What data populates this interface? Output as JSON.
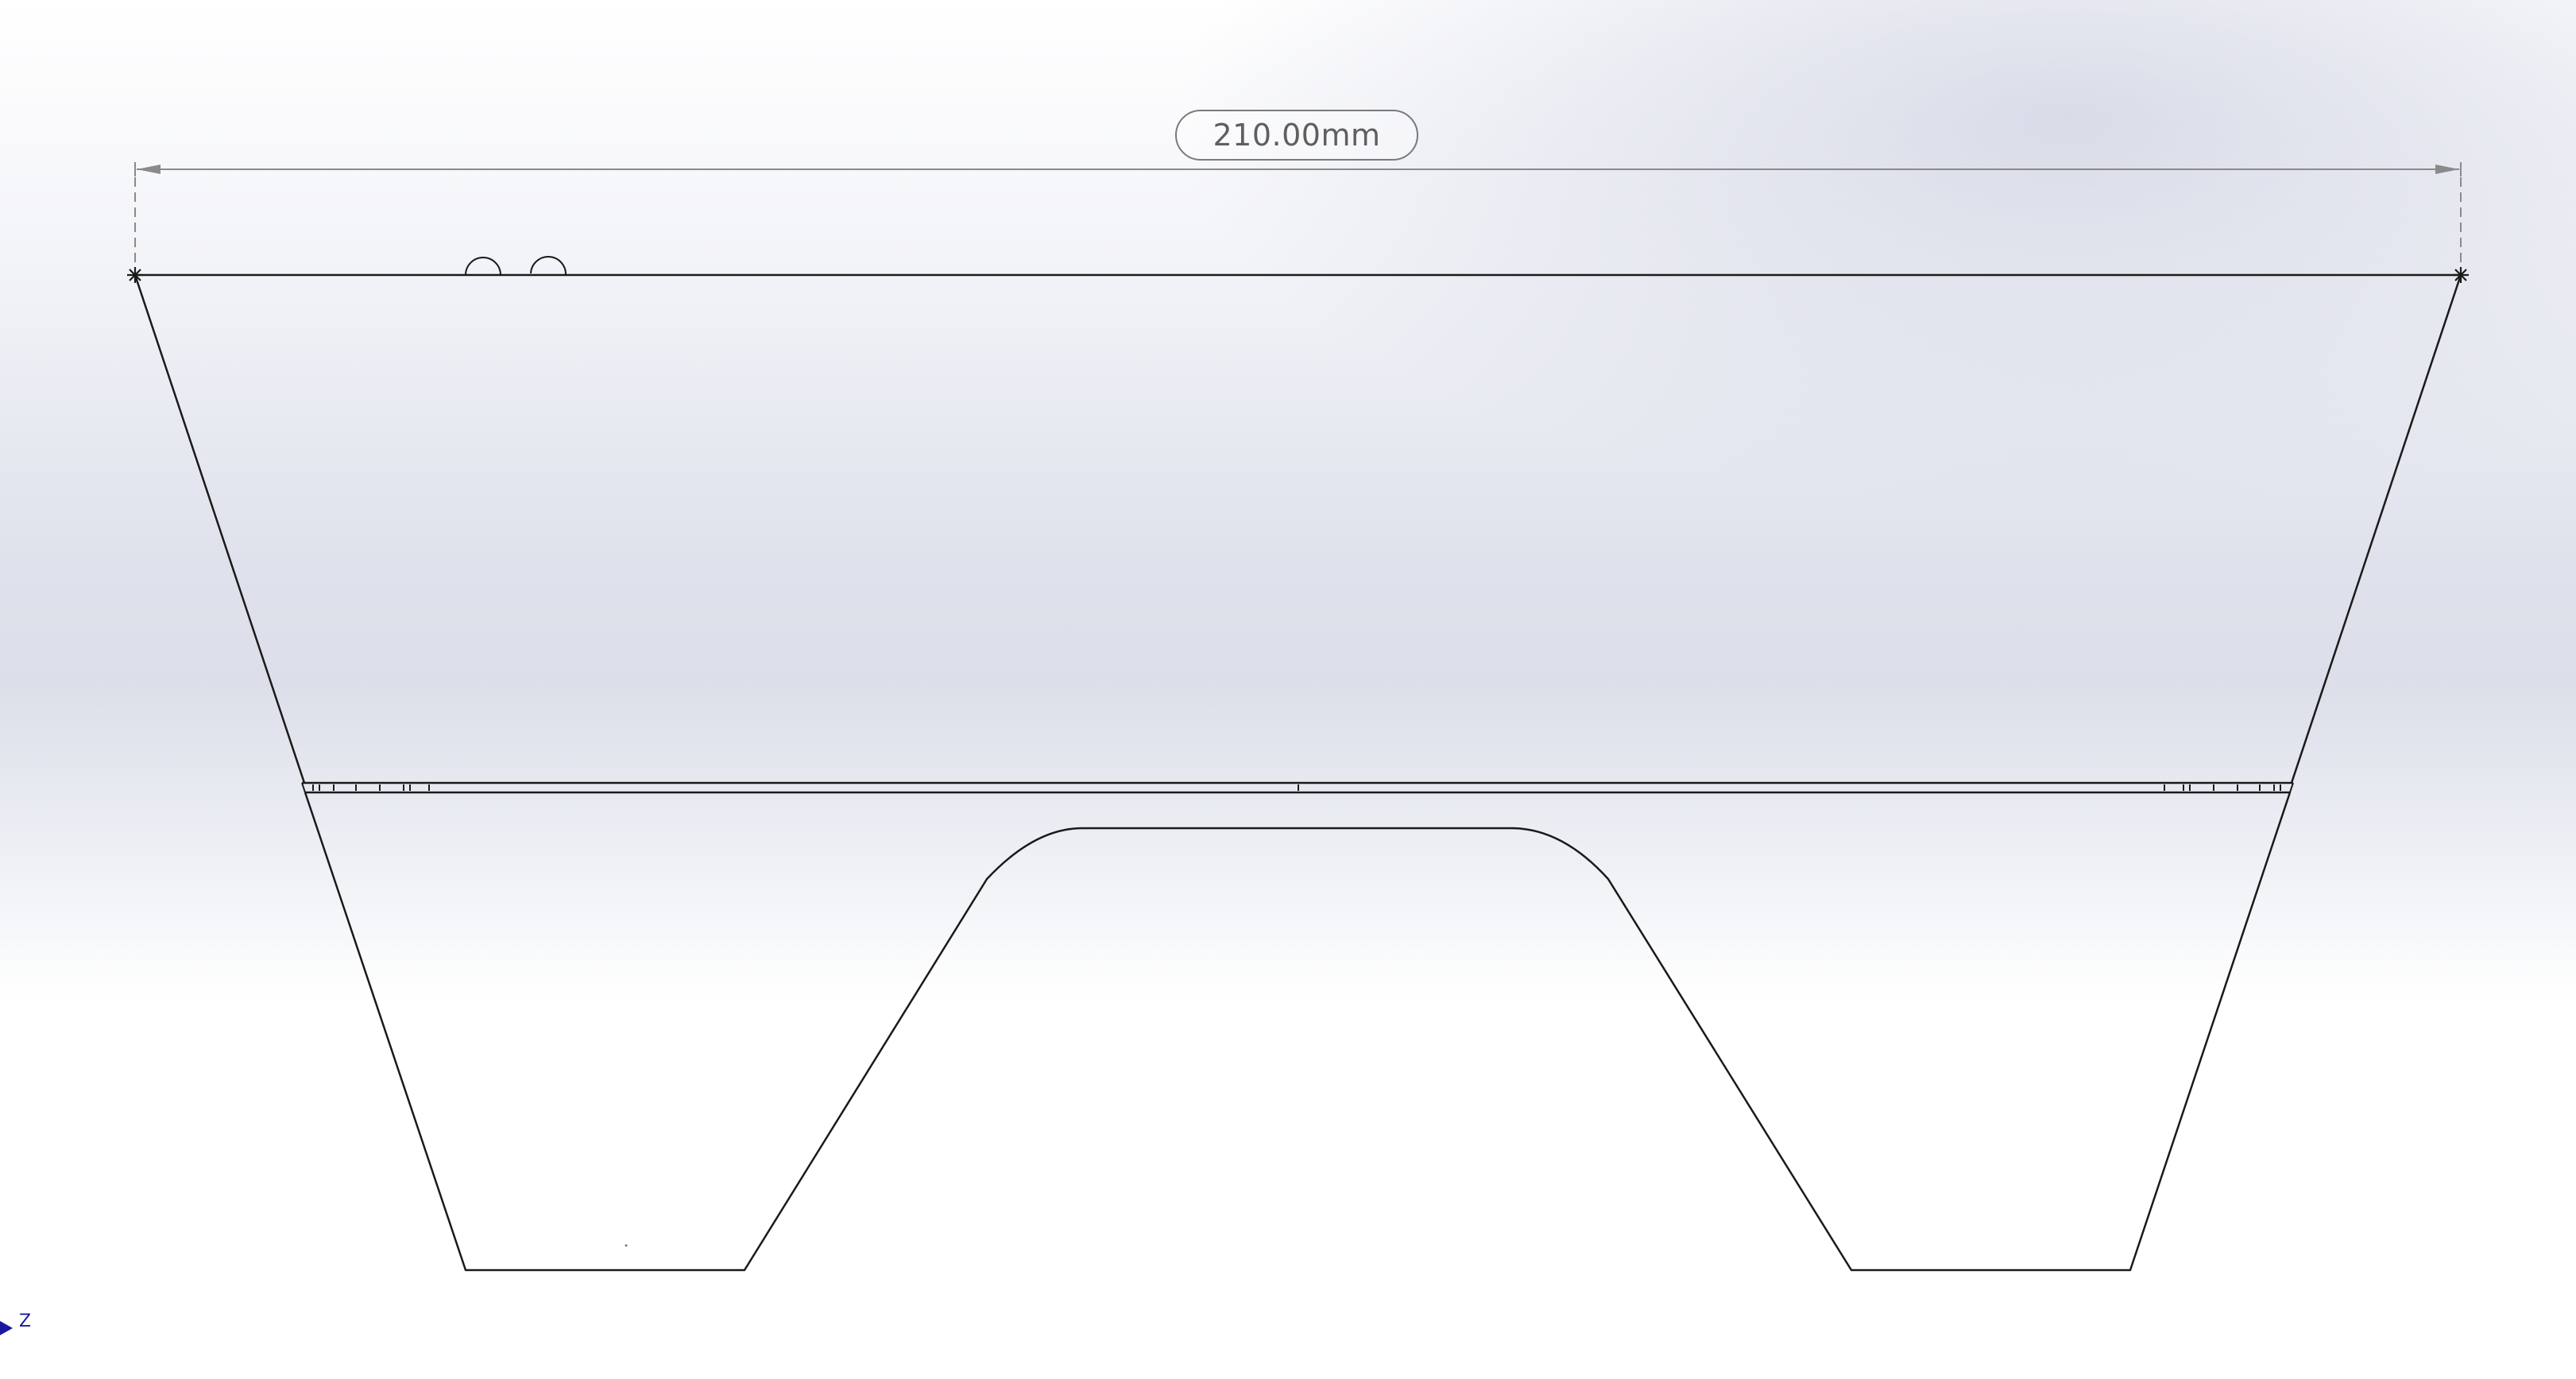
{
  "viewport": {
    "view": "front"
  },
  "dimension": {
    "value_label": "210.00mm"
  },
  "triad": {
    "axis_label": "Z"
  },
  "colors": {
    "sketch_line": "#1a1a1a",
    "dimension_line": "#8a8a8a",
    "dimension_text": "#5f5f5f",
    "triad_axis": "#1a1aa0"
  }
}
